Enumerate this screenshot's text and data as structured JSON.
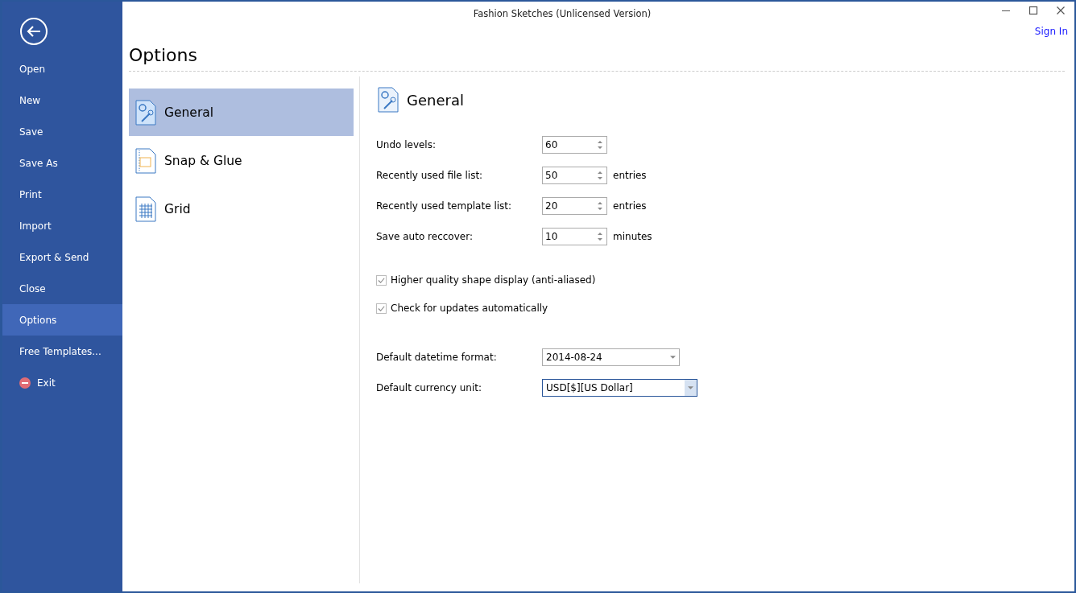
{
  "window": {
    "title": "Fashion Sketches (Unlicensed Version)"
  },
  "sign_in": "Sign In",
  "sidebar": {
    "items": [
      {
        "label": "Open",
        "selected": false,
        "kind": "plain"
      },
      {
        "label": "New",
        "selected": false,
        "kind": "plain"
      },
      {
        "label": "Save",
        "selected": false,
        "kind": "plain"
      },
      {
        "label": "Save As",
        "selected": false,
        "kind": "plain"
      },
      {
        "label": "Print",
        "selected": false,
        "kind": "plain"
      },
      {
        "label": "Import",
        "selected": false,
        "kind": "plain"
      },
      {
        "label": "Export & Send",
        "selected": false,
        "kind": "plain"
      },
      {
        "label": "Close",
        "selected": false,
        "kind": "plain"
      },
      {
        "label": "Options",
        "selected": true,
        "kind": "plain"
      },
      {
        "label": "Free Templates...",
        "selected": false,
        "kind": "plain"
      },
      {
        "label": "Exit",
        "selected": false,
        "kind": "exit"
      }
    ]
  },
  "heading": "Options",
  "categories": [
    {
      "label": "General",
      "selected": true,
      "kind": "general"
    },
    {
      "label": "Snap & Glue",
      "selected": false,
      "kind": "snap"
    },
    {
      "label": "Grid",
      "selected": false,
      "kind": "grid"
    }
  ],
  "section_title": "General",
  "spin_settings": [
    {
      "label": "Undo levels:",
      "value": "60"
    },
    {
      "label": "Recently used file list:",
      "value": "50",
      "unit": "entries"
    },
    {
      "label": "Recently used template list:",
      "value": "20",
      "unit": "entries"
    },
    {
      "label": "Save auto reccover:",
      "value": "10",
      "unit": "minutes"
    }
  ],
  "checkboxes": [
    {
      "label": "Higher quality shape display (anti-aliased)",
      "checked": true
    },
    {
      "label": "Check for updates automatically",
      "checked": true
    }
  ],
  "dropdowns": [
    {
      "label": "Default datetime format:",
      "value": "2014-08-24",
      "focused": false
    },
    {
      "label": "Default currency unit:",
      "value": "USD[$][US Dollar]",
      "focused": true
    }
  ]
}
